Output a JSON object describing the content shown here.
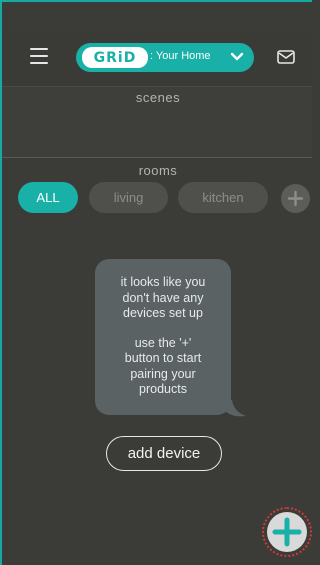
{
  "header": {
    "logo_text": "GRiD",
    "home_label": ": Your Home"
  },
  "scenes": {
    "title": "scenes"
  },
  "rooms": {
    "title": "rooms",
    "items": [
      {
        "label": "ALL",
        "active": true
      },
      {
        "label": "living",
        "active": false
      },
      {
        "label": "kitchen",
        "active": false
      }
    ]
  },
  "empty_state": {
    "line1": "it looks like you\ndon't have any\ndevices set up",
    "line2": "use the '+'\nbutton to start\npairing your\nproducts"
  },
  "actions": {
    "add_device_label": "add device"
  },
  "colors": {
    "accent": "#19b0a8",
    "background": "#3b3c38",
    "bubble": "#5b6264",
    "fab_ring": "#d23a3a"
  },
  "icons": {
    "menu": "menu-icon",
    "mail": "mail-icon",
    "chevron": "chevron-down-icon",
    "add_room": "plus-icon",
    "fab": "plus-icon"
  }
}
